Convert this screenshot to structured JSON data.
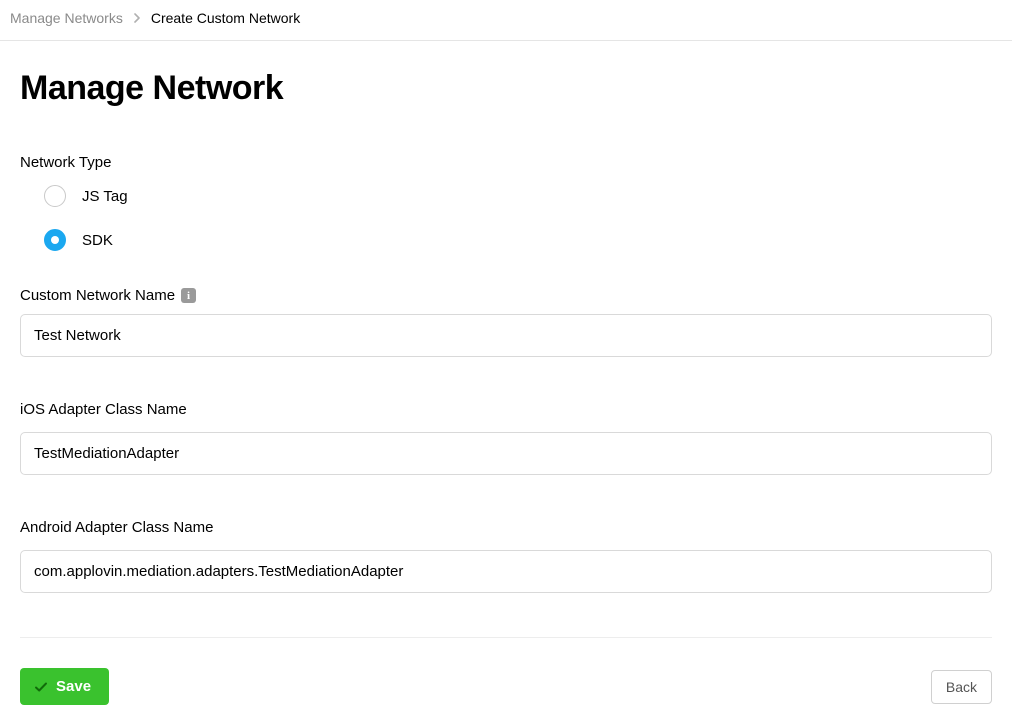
{
  "breadcrumb": {
    "parent": "Manage Networks",
    "current": "Create Custom Network"
  },
  "page": {
    "title": "Manage Network"
  },
  "form": {
    "network_type_label": "Network Type",
    "network_type_options": [
      {
        "label": "JS Tag",
        "selected": false
      },
      {
        "label": "SDK",
        "selected": true
      }
    ],
    "custom_name_label": "Custom Network Name",
    "custom_name_value": "Test Network",
    "ios_adapter_label": "iOS Adapter Class Name",
    "ios_adapter_value": "TestMediationAdapter",
    "android_adapter_label": "Android Adapter Class Name",
    "android_adapter_value": "com.applovin.mediation.adapters.TestMediationAdapter"
  },
  "buttons": {
    "save": "Save",
    "back": "Back"
  }
}
